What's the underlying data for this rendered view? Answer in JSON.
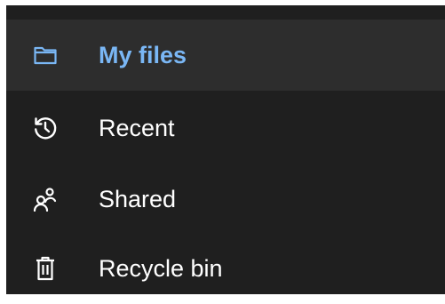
{
  "nav": {
    "items": [
      {
        "label": "My files",
        "icon": "folder-icon",
        "selected": true
      },
      {
        "label": "Recent",
        "icon": "clock-history-icon",
        "selected": false
      },
      {
        "label": "Shared",
        "icon": "people-icon",
        "selected": false
      },
      {
        "label": "Recycle bin",
        "icon": "trash-icon",
        "selected": false
      }
    ]
  },
  "colors": {
    "background": "#1f1f1f",
    "selected_background": "#2d2d2d",
    "accent": "#7ab7f5",
    "text": "#ffffff"
  }
}
